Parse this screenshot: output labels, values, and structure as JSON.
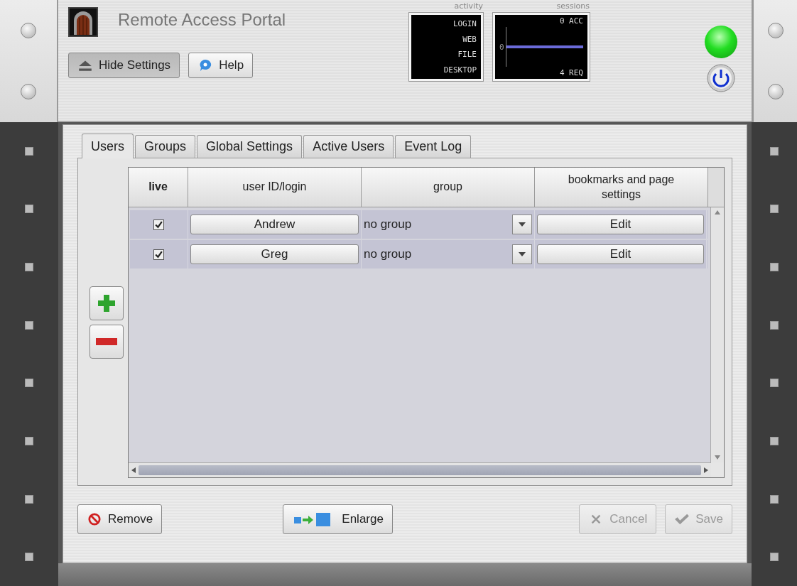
{
  "header": {
    "title": "Remote Access Portal",
    "buttons": [
      {
        "label": "Hide Settings",
        "kind": "eject",
        "pressed": true
      },
      {
        "label": "Help",
        "kind": "help",
        "pressed": false
      }
    ]
  },
  "activity": {
    "label": "activity",
    "lines": [
      "LOGIN",
      "WEB",
      "FILE",
      "DESKTOP"
    ]
  },
  "sessions": {
    "label": "sessions",
    "top": "0 ACC",
    "axis": "0",
    "bottom": "4 REQ"
  },
  "status": {
    "on": true
  },
  "tabs": [
    {
      "label": "Users",
      "selected": true
    },
    {
      "label": "Groups",
      "selected": false
    },
    {
      "label": "Global Settings",
      "selected": false
    },
    {
      "label": "Active Users",
      "selected": false
    },
    {
      "label": "Event Log",
      "selected": false
    }
  ],
  "table": {
    "columns": [
      "live",
      "user ID/login",
      "group",
      "bookmarks and page settings"
    ],
    "rows": [
      {
        "live": true,
        "user": "Andrew",
        "group": "no group",
        "action": "Edit"
      },
      {
        "live": true,
        "user": "Greg",
        "group": "no group",
        "action": "Edit"
      }
    ]
  },
  "footer": {
    "buttons": [
      {
        "label": "Remove",
        "kind": "remove",
        "disabled": false
      },
      {
        "label": "Enlarge",
        "kind": "enlarge",
        "disabled": false
      },
      {
        "label": "Cancel",
        "kind": "cancel",
        "disabled": true
      },
      {
        "label": "Save",
        "kind": "save",
        "disabled": true
      }
    ]
  }
}
